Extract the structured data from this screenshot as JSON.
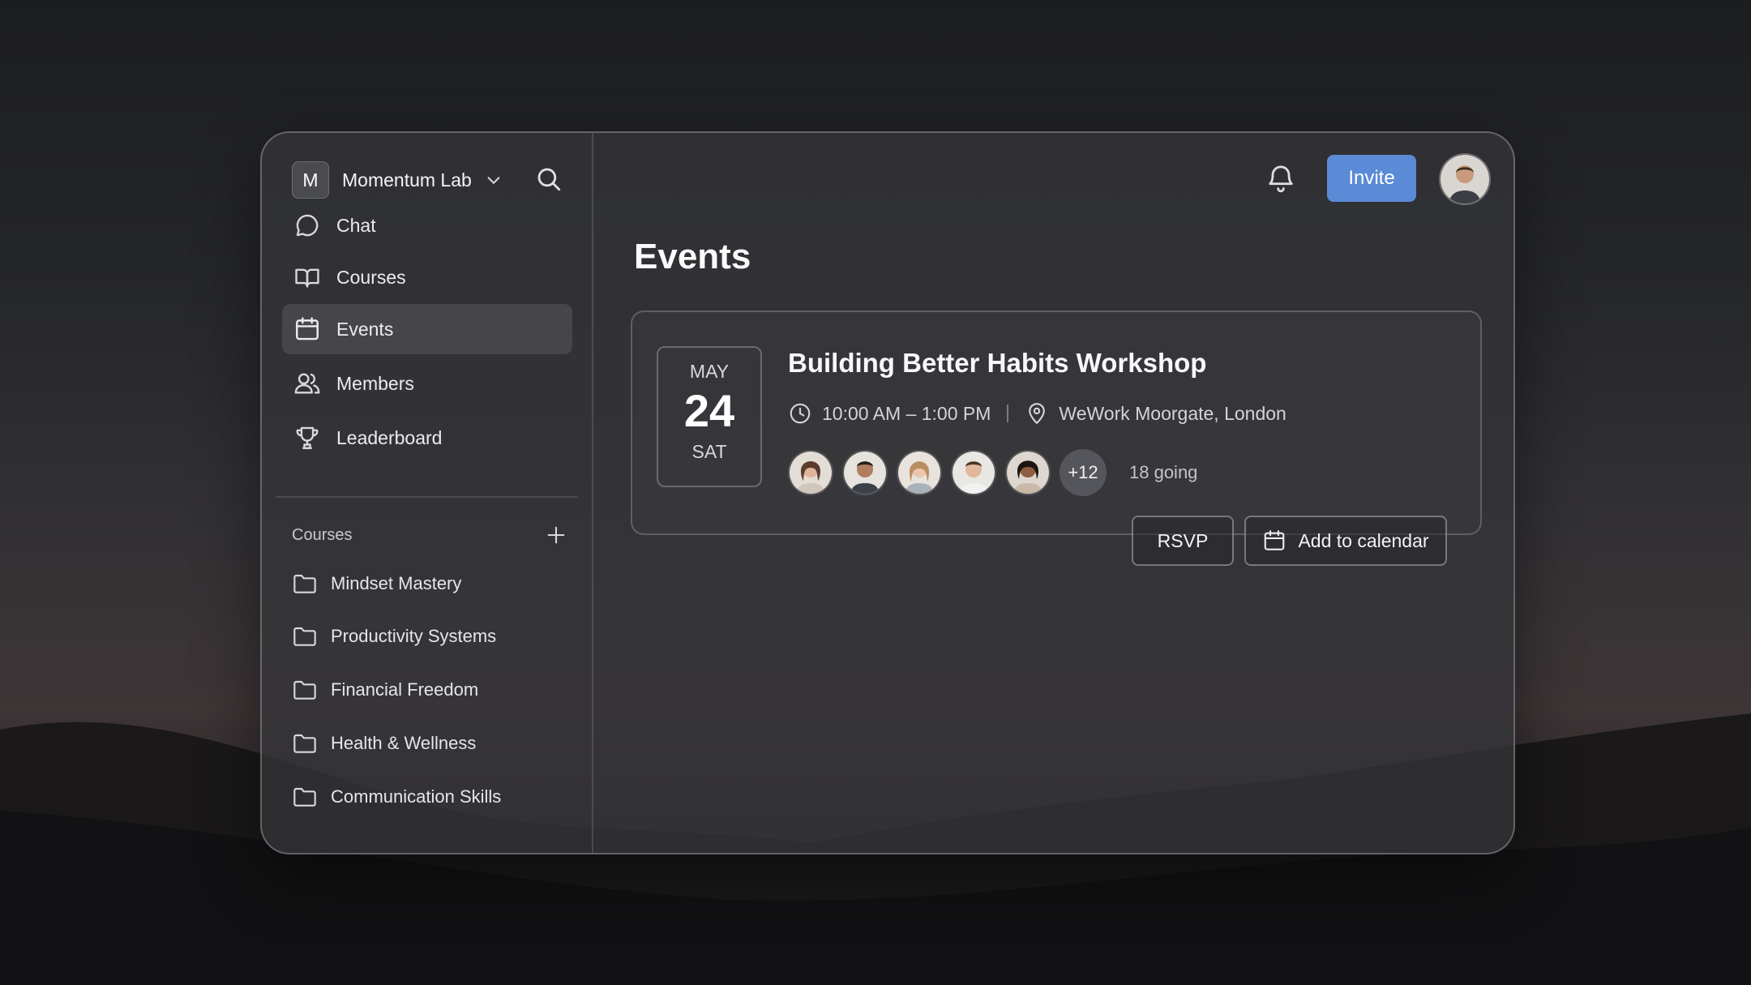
{
  "workspace": {
    "initial": "M",
    "name": "Momentum Lab"
  },
  "nav": {
    "items": [
      {
        "label": "Chat",
        "icon": "chat-icon"
      },
      {
        "label": "Courses",
        "icon": "book-icon"
      },
      {
        "label": "Events",
        "icon": "calendar-icon",
        "active": true
      },
      {
        "label": "Members",
        "icon": "members-icon"
      },
      {
        "label": "Leaderboard",
        "icon": "trophy-icon"
      }
    ]
  },
  "courses": {
    "heading": "Courses",
    "items": [
      {
        "label": "Mindset Mastery"
      },
      {
        "label": "Productivity Systems"
      },
      {
        "label": "Financial Freedom"
      },
      {
        "label": "Health & Wellness"
      },
      {
        "label": "Communication Skills"
      }
    ]
  },
  "header": {
    "invite_label": "Invite"
  },
  "main": {
    "title": "Events"
  },
  "event": {
    "month": "MAY",
    "day": "24",
    "weekday": "SAT",
    "title": "Building Better Habits Workshop",
    "time": "10:00 AM – 1:00 PM",
    "location": "WeWork Moorgate, London",
    "more_count": "+12",
    "going": "18 going",
    "rsvp_label": "RSVP",
    "calendar_label": "Add to calendar"
  },
  "colors": {
    "accent": "#5b8ad6",
    "panel": "#343439",
    "text": "#f2f2f4"
  }
}
